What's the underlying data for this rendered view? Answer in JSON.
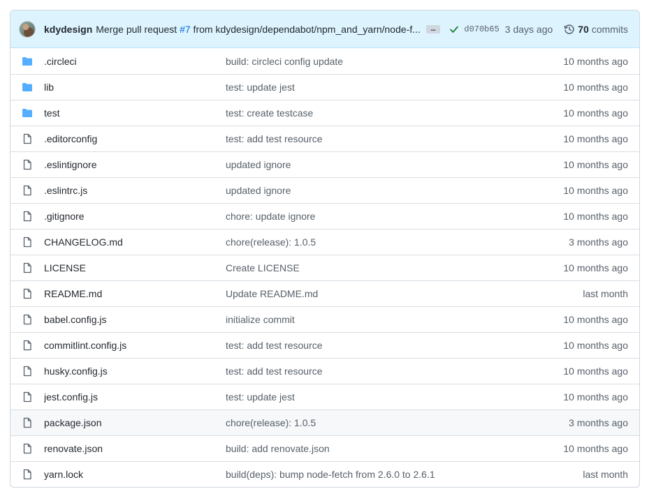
{
  "commit": {
    "author": "kdydesign",
    "message_prefix": "Merge pull request ",
    "pr_ref": "#7",
    "message_suffix": " from kdydesign/dependabot/npm_and_yarn/node-f...",
    "ellipsis": "...",
    "sha": "d070b65",
    "when": "3 days ago",
    "commits_count": "70",
    "commits_label": "commits",
    "status_color": "#1a7f37"
  },
  "files": [
    {
      "type": "dir",
      "icon": "folder-icon",
      "name": ".circleci",
      "message": "build: circleci config update",
      "age": "10 months ago"
    },
    {
      "type": "dir",
      "icon": "folder-icon",
      "name": "lib",
      "message": "test: update jest",
      "age": "10 months ago"
    },
    {
      "type": "dir",
      "icon": "folder-icon",
      "name": "test",
      "message": "test: create testcase",
      "age": "10 months ago"
    },
    {
      "type": "file",
      "icon": "file-icon",
      "name": ".editorconfig",
      "message": "test: add test resource",
      "age": "10 months ago"
    },
    {
      "type": "file",
      "icon": "file-icon",
      "name": ".eslintignore",
      "message": "updated ignore",
      "age": "10 months ago"
    },
    {
      "type": "file",
      "icon": "file-icon",
      "name": ".eslintrc.js",
      "message": "updated ignore",
      "age": "10 months ago"
    },
    {
      "type": "file",
      "icon": "file-icon",
      "name": ".gitignore",
      "message": "chore: update ignore",
      "age": "10 months ago"
    },
    {
      "type": "file",
      "icon": "file-icon",
      "name": "CHANGELOG.md",
      "message": "chore(release): 1.0.5",
      "age": "3 months ago"
    },
    {
      "type": "file",
      "icon": "file-icon",
      "name": "LICENSE",
      "message": "Create LICENSE",
      "age": "10 months ago"
    },
    {
      "type": "file",
      "icon": "file-icon",
      "name": "README.md",
      "message": "Update README.md",
      "age": "last month"
    },
    {
      "type": "file",
      "icon": "file-icon",
      "name": "babel.config.js",
      "message": "initialize commit",
      "age": "10 months ago"
    },
    {
      "type": "file",
      "icon": "file-icon",
      "name": "commitlint.config.js",
      "message": "test: add test resource",
      "age": "10 months ago"
    },
    {
      "type": "file",
      "icon": "file-icon",
      "name": "husky.config.js",
      "message": "test: add test resource",
      "age": "10 months ago"
    },
    {
      "type": "file",
      "icon": "file-icon",
      "name": "jest.config.js",
      "message": "test: update jest",
      "age": "10 months ago"
    },
    {
      "type": "file",
      "icon": "file-icon",
      "name": "package.json",
      "message": "chore(release): 1.0.5",
      "age": "3 months ago",
      "hover": true
    },
    {
      "type": "file",
      "icon": "file-icon",
      "name": "renovate.json",
      "message": "build: add renovate.json",
      "age": "10 months ago"
    },
    {
      "type": "file",
      "icon": "file-icon",
      "name": "yarn.lock",
      "message": "build(deps): bump node-fetch from 2.6.0 to 2.6.1",
      "age": "last month"
    }
  ],
  "colors": {
    "folder": "#54aeff",
    "file_icon": "#57606a",
    "header_bg": "#ddf4ff",
    "link": "#0969da"
  }
}
